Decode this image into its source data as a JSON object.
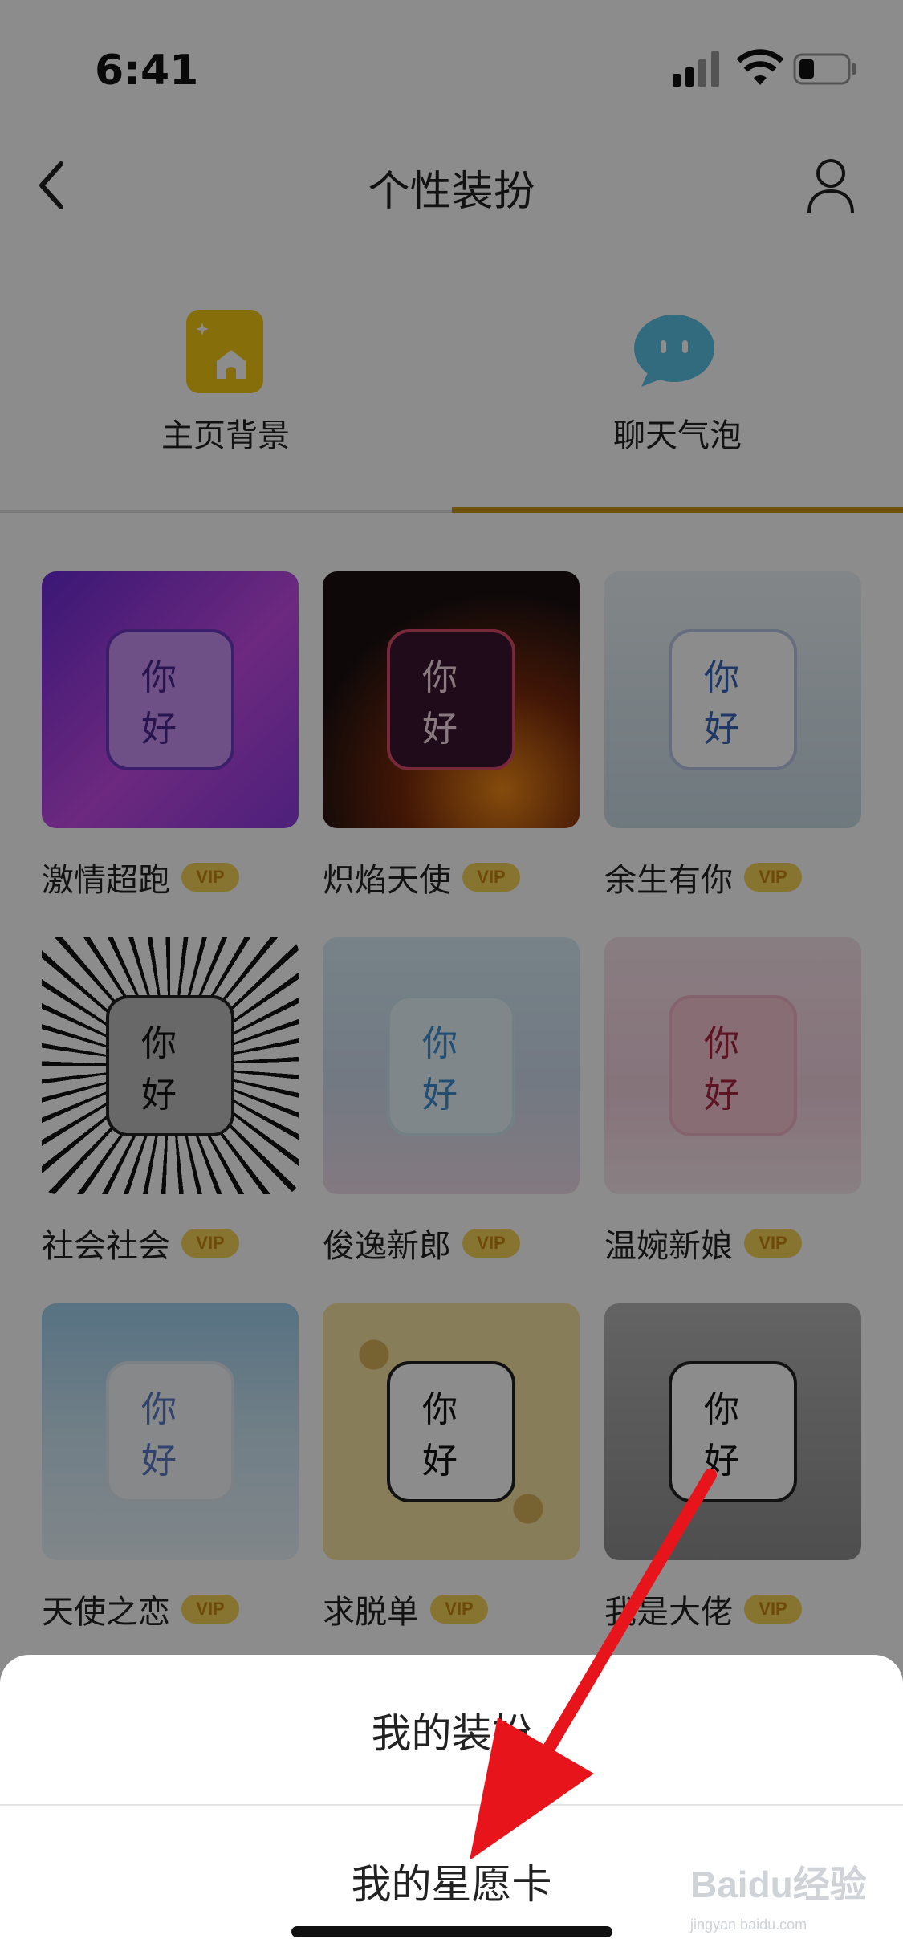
{
  "status_bar": {
    "time": "6:41"
  },
  "nav": {
    "title": "个性装扮"
  },
  "tabs": [
    {
      "label": "主页背景",
      "icon": "home-card-icon"
    },
    {
      "label": "聊天气泡",
      "icon": "chat-bubble-icon",
      "selected": true
    }
  ],
  "colors": {
    "accent": "#C99A14",
    "vip_bg": "#F7D35A",
    "vip_text": "#C8860E"
  },
  "bubbles": [
    {
      "name": "激情超跑",
      "badge": "VIP",
      "preview_text": "你好"
    },
    {
      "name": "炽焰天使",
      "badge": "VIP",
      "preview_text": "你好"
    },
    {
      "name": "余生有你",
      "badge": "VIP",
      "preview_text": "你好"
    },
    {
      "name": "社会社会",
      "badge": "VIP",
      "preview_text": "你好"
    },
    {
      "name": "俊逸新郎",
      "badge": "VIP",
      "preview_text": "你好"
    },
    {
      "name": "温婉新娘",
      "badge": "VIP",
      "preview_text": "你好"
    },
    {
      "name": "天使之恋",
      "badge": "VIP",
      "preview_text": "你好"
    },
    {
      "name": "求脱单",
      "badge": "VIP",
      "preview_text": "你好"
    },
    {
      "name": "我是大佬",
      "badge": "VIP",
      "preview_text": "你好"
    }
  ],
  "sheet": {
    "items": [
      "我的装扮",
      "我的星愿卡"
    ]
  },
  "watermark": {
    "brand": "Baidu经验",
    "url": "jingyan.baidu.com"
  }
}
